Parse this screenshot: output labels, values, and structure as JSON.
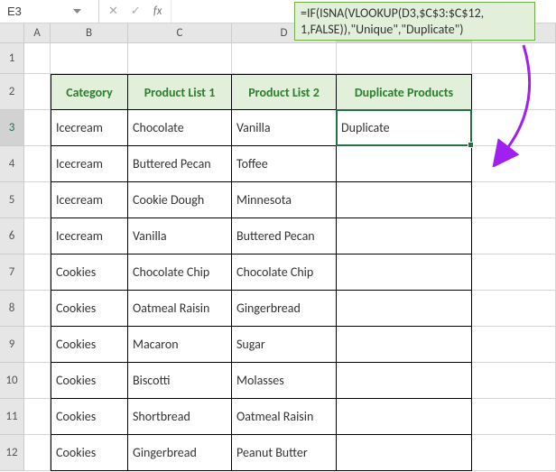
{
  "nameBox": "E3",
  "formulaTooltip": {
    "line1": "=IF(ISNA(VLOOKUP(D3,$C$3:$C$12,",
    "line2": "1,FALSE)),\"Unique\",\"Duplicate\")"
  },
  "fxLabel": "fx",
  "columns": [
    "A",
    "B",
    "C",
    "D",
    "E"
  ],
  "activeCol": "E",
  "activeRow": "3",
  "rows": [
    "1",
    "2",
    "3",
    "4",
    "5",
    "6",
    "7",
    "8",
    "9",
    "10",
    "11",
    "12"
  ],
  "headers": {
    "B": "Category",
    "C": "Product List 1",
    "D": "Product List 2",
    "E": "Duplicate Products"
  },
  "data": [
    {
      "B": "Icecream",
      "C": "Chocolate",
      "D": "Vanilla",
      "E": "Duplicate"
    },
    {
      "B": "Icecream",
      "C": "Buttered Pecan",
      "D": "Toffee",
      "E": ""
    },
    {
      "B": "Icecream",
      "C": "Cookie Dough",
      "D": "Minnesota",
      "E": ""
    },
    {
      "B": "Icecream",
      "C": "Vanilla",
      "D": "Buttered Pecan",
      "E": ""
    },
    {
      "B": "Cookies",
      "C": "Chocolate Chip",
      "D": "Chocolate Chip",
      "E": ""
    },
    {
      "B": "Cookies",
      "C": "Oatmeal Raisin",
      "D": "Gingerbread",
      "E": ""
    },
    {
      "B": "Cookies",
      "C": "Macaron",
      "D": "Sugar",
      "E": ""
    },
    {
      "B": "Cookies",
      "C": "Biscotti",
      "D": "Molasses",
      "E": ""
    },
    {
      "B": "Cookies",
      "C": "Shortbread",
      "D": "Oatmeal Raisin",
      "E": ""
    },
    {
      "B": "Cookies",
      "C": "Gingerbread",
      "D": "Peanut Butter",
      "E": ""
    }
  ],
  "chart_data": {
    "type": "table",
    "title": "",
    "columns": [
      "Category",
      "Product List 1",
      "Product List 2",
      "Duplicate Products"
    ],
    "rows": [
      [
        "Icecream",
        "Chocolate",
        "Vanilla",
        "Duplicate"
      ],
      [
        "Icecream",
        "Buttered Pecan",
        "Toffee",
        ""
      ],
      [
        "Icecream",
        "Cookie Dough",
        "Minnesota",
        ""
      ],
      [
        "Icecream",
        "Vanilla",
        "Buttered Pecan",
        ""
      ],
      [
        "Cookies",
        "Chocolate Chip",
        "Chocolate Chip",
        ""
      ],
      [
        "Cookies",
        "Oatmeal Raisin",
        "Gingerbread",
        ""
      ],
      [
        "Cookies",
        "Macaron",
        "Sugar",
        ""
      ],
      [
        "Cookies",
        "Biscotti",
        "Molasses",
        ""
      ],
      [
        "Cookies",
        "Shortbread",
        "Oatmeal Raisin",
        ""
      ],
      [
        "Cookies",
        "Gingerbread",
        "Peanut Butter",
        ""
      ]
    ]
  }
}
